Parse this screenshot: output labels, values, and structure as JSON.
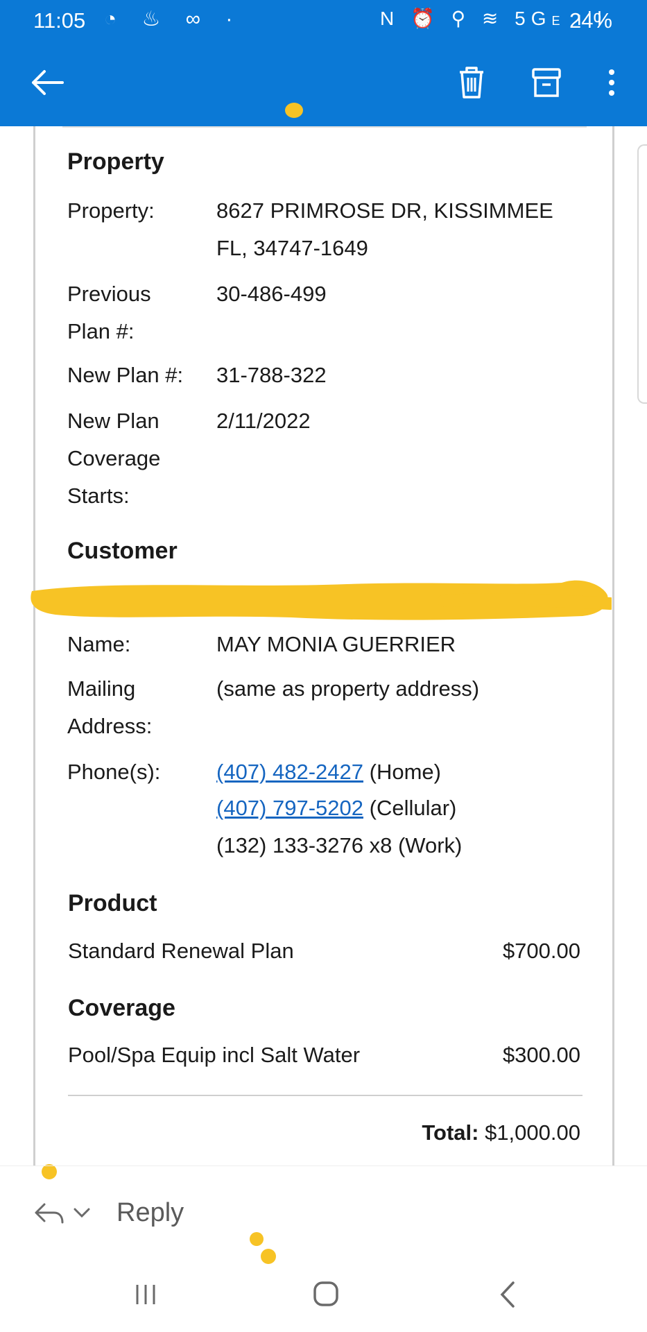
{
  "status_bar": {
    "time": "11:05",
    "network": "5G",
    "network_sub": "E",
    "battery": "24%"
  },
  "toolbar": {
    "back_icon": "arrow-left-icon",
    "delete_icon": "trash-icon",
    "archive_icon": "archive-icon",
    "more_icon": "more-vert-icon"
  },
  "property": {
    "heading": "Property",
    "property_label": "Property:",
    "property_value_line1": "8627 PRIMROSE DR, KISSIMMEE",
    "property_value_line2": "FL, 34747-1649",
    "prev_plan_label_line1": "Previous",
    "prev_plan_label_line2": "Plan #:",
    "prev_plan_value": "30-486-499",
    "new_plan_label": "New Plan #:",
    "new_plan_value": "31-788-322",
    "coverage_label_line1": "New Plan",
    "coverage_label_line2": "Coverage",
    "coverage_label_line3": "Starts:",
    "coverage_value": "2/11/2022"
  },
  "customer": {
    "heading": "Customer",
    "name_label": "Name:",
    "name_value": "MAY MONIA GUERRIER",
    "mailing_label_line1": "Mailing",
    "mailing_label_line2": "Address:",
    "mailing_value": "(same as property address)",
    "phones_label": "Phone(s):",
    "phones": [
      {
        "number": "(407) 482-2427",
        "type": "(Home)"
      },
      {
        "number": "(407) 797-5202",
        "type": "(Cellular)"
      },
      {
        "number": "(132) 133-3276 x8",
        "type": "(Work)"
      }
    ]
  },
  "product": {
    "heading": "Product",
    "item": "Standard Renewal Plan",
    "price": "$700.00"
  },
  "coverage": {
    "heading": "Coverage",
    "item": "Pool/Spa Equip incl Salt Water",
    "price": "$300.00"
  },
  "total": {
    "label": "Total:",
    "value": "$1,000.00"
  },
  "reply_bar": {
    "reply_label": "Reply"
  },
  "colors": {
    "appbar": "#0b79d6",
    "link": "#1565c0",
    "redaction": "#f7c325"
  }
}
